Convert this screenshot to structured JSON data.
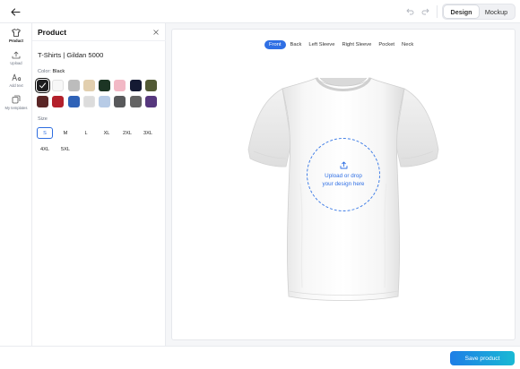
{
  "toolbar": {
    "back_icon": "arrow-left-icon",
    "undo_icon": "undo-icon",
    "redo_icon": "redo-icon",
    "modes": [
      {
        "label": "Design",
        "active": true
      },
      {
        "label": "Mockup",
        "active": false
      }
    ]
  },
  "rail": {
    "items": [
      {
        "label": "Product",
        "icon": "tshirt-icon",
        "active": true
      },
      {
        "label": "Upload",
        "icon": "upload-icon",
        "active": false
      },
      {
        "label": "Add text",
        "icon": "text-icon",
        "active": false
      },
      {
        "label": "My templates",
        "icon": "templates-icon",
        "active": false
      }
    ]
  },
  "panel": {
    "title": "Product",
    "close_icon": "close-icon",
    "product_name": "T-Shirts | Gildan 5000",
    "color_label": "Color:",
    "color_value": "Black",
    "swatches": [
      {
        "color": "#1d1d1f",
        "selected": true
      },
      {
        "color": "#f7f7f7",
        "selected": false
      },
      {
        "color": "#bcbcbc",
        "selected": false
      },
      {
        "color": "#e2cfae",
        "selected": false
      },
      {
        "color": "#1c3524",
        "selected": false
      },
      {
        "color": "#f2b8c5",
        "selected": false
      },
      {
        "color": "#141a33",
        "selected": false
      },
      {
        "color": "#525a35",
        "selected": false
      },
      {
        "color": "#5a2626",
        "selected": false
      },
      {
        "color": "#b3202b",
        "selected": false
      },
      {
        "color": "#2f62b7",
        "selected": false
      },
      {
        "color": "#dcdcdc",
        "selected": false
      },
      {
        "color": "#b7cbe6",
        "selected": false
      },
      {
        "color": "#58595b",
        "selected": false
      },
      {
        "color": "#646464",
        "selected": false
      },
      {
        "color": "#56377d",
        "selected": false
      }
    ],
    "size_label": "Size",
    "sizes": [
      {
        "label": "S",
        "selected": true
      },
      {
        "label": "M",
        "selected": false
      },
      {
        "label": "L",
        "selected": false
      },
      {
        "label": "XL",
        "selected": false
      },
      {
        "label": "2XL",
        "selected": false
      },
      {
        "label": "3XL",
        "selected": false
      },
      {
        "label": "4XL",
        "selected": false
      },
      {
        "label": "5XL",
        "selected": false
      }
    ]
  },
  "canvas": {
    "views": [
      {
        "label": "Front",
        "active": true
      },
      {
        "label": "Back",
        "active": false
      },
      {
        "label": "Left Sleeve",
        "active": false
      },
      {
        "label": "Right Sleeve",
        "active": false
      },
      {
        "label": "Pocket",
        "active": false
      },
      {
        "label": "Neck",
        "active": false
      }
    ],
    "drop_icon": "upload-icon",
    "drop_text_line1": "Upload or drop",
    "drop_text_line2": "your design here"
  },
  "footer": {
    "save_label": "Save product"
  },
  "colors": {
    "accent": "#2f6fe4",
    "save_gradient_start": "#1e7ee6",
    "save_gradient_end": "#19b9d4"
  }
}
